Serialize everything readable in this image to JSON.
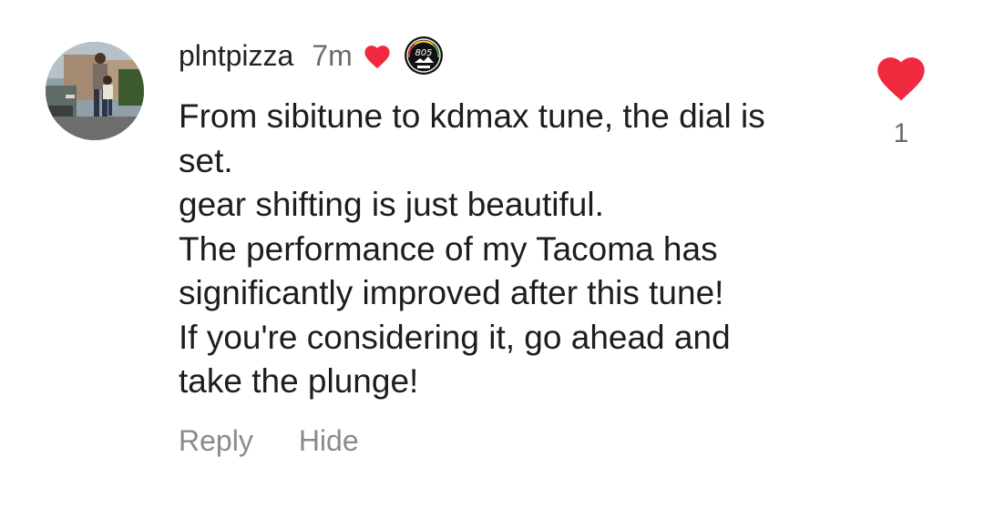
{
  "comment": {
    "username": "plntpizza",
    "timestamp": "7m",
    "badge": {
      "icon": "badge-805-icon",
      "text": "805"
    },
    "creator_heart_icon": "heart-icon",
    "body_lines": [
      "From sibitune to kdmax tune, the dial is",
      "set.",
      "gear shifting is just beautiful.",
      "The performance of my Tacoma has",
      "significantly improved after this tune!",
      "If you're considering it, go ahead and",
      "take the plunge!"
    ],
    "actions": {
      "reply": "Reply",
      "hide": "Hide"
    },
    "likes": {
      "count": "1",
      "liked": true,
      "icon": "heart-icon"
    }
  },
  "colors": {
    "heart": "#f0293f",
    "username": "#222222",
    "muted": "#8a8a8a",
    "text": "#1d1d1d"
  }
}
